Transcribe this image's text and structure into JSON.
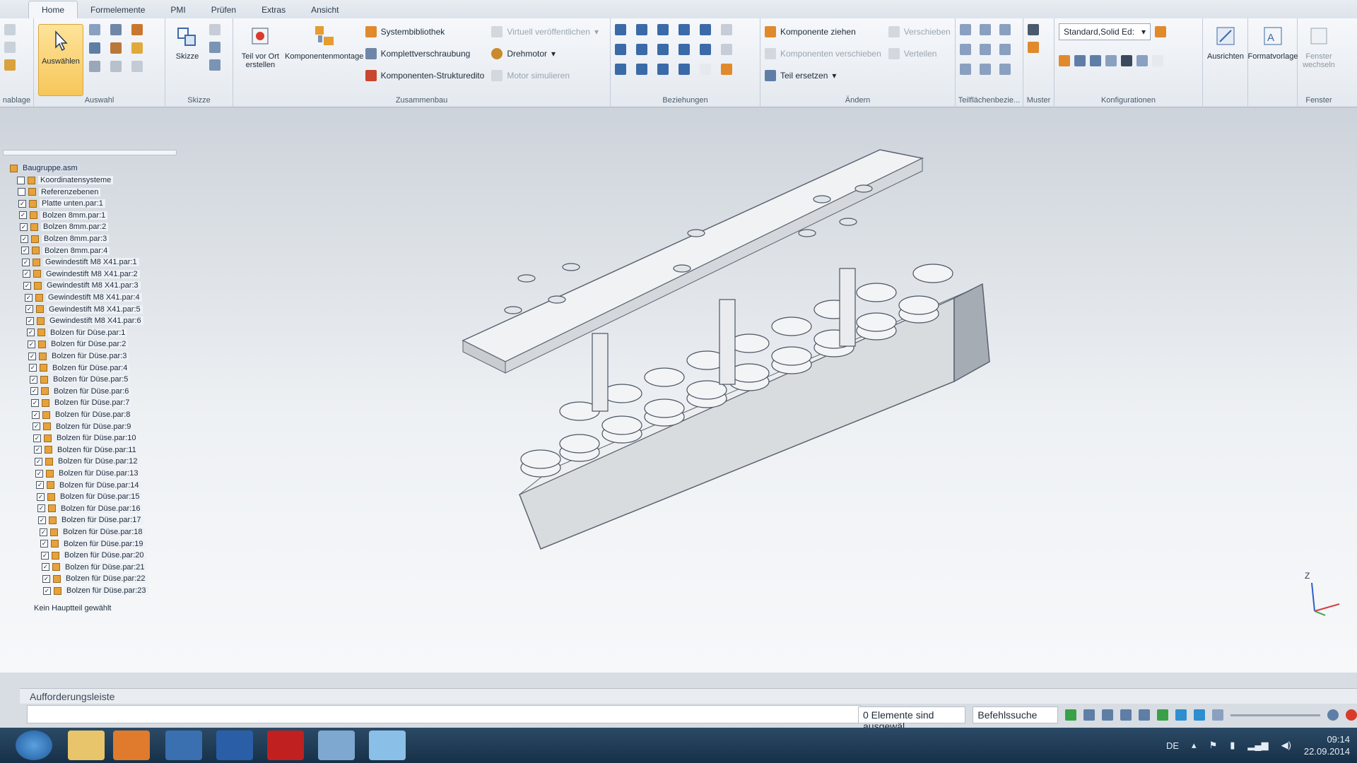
{
  "tabs": [
    "Home",
    "Formelemente",
    "PMI",
    "Prüfen",
    "Extras",
    "Ansicht"
  ],
  "ribbon": {
    "group_auswahl": {
      "label": "Auswahl",
      "button": "Auswählen"
    },
    "group_left": {
      "label": "nablage"
    },
    "group_skizze": {
      "label": "Skizze",
      "button": "Skizze"
    },
    "group_zusammenbau": {
      "label": "Zusammenbau",
      "teil_vor_ort": "Teil vor Ort erstellen",
      "komponentenmontage": "Komponentenmontage",
      "systembibliothek": "Systembibliothek",
      "komplettverschraubung": "Komplettverschraubung",
      "komponenten_strukturedito": "Komponenten-Strukturedito",
      "virtuell": "Virtuell veröffentlichen",
      "drehmotor": "Drehmotor",
      "motor_simulieren": "Motor simulieren"
    },
    "group_beziehungen": {
      "label": "Beziehungen"
    },
    "group_aendern": {
      "label": "Ändern",
      "komponente_ziehen": "Komponente ziehen",
      "komponenten_verschieben": "Komponenten verschieben",
      "teil_ersetzen": "Teil ersetzen",
      "verschieben": "Verschieben",
      "verteilen": "Verteilen"
    },
    "group_teilflaechen": {
      "label": "Teilflächenbezie..."
    },
    "group_muster": {
      "label": "Muster"
    },
    "group_konfig": {
      "label": "Konfigurationen",
      "combo": "Standard,Solid Ed:"
    },
    "group_ausrichten": {
      "label": "Ausrichten"
    },
    "group_formatvorlage": {
      "label": "Formatvorlage"
    },
    "group_fenster": {
      "label": "Fenster",
      "button": "Fenster wechseln"
    }
  },
  "tree": {
    "root": "Baugruppe.asm",
    "items": [
      "Koordinatensysteme",
      "Referenzebenen",
      "Platte unten.par:1",
      "Bolzen 8mm.par:1",
      "Bolzen 8mm.par:2",
      "Bolzen 8mm.par:3",
      "Bolzen 8mm.par:4",
      "Gewindestift M8 X41.par:1",
      "Gewindestift M8 X41.par:2",
      "Gewindestift M8 X41.par:3",
      "Gewindestift M8 X41.par:4",
      "Gewindestift M8 X41.par:5",
      "Gewindestift M8 X41.par:6",
      "Bolzen für Düse.par:1",
      "Bolzen für Düse.par:2",
      "Bolzen für Düse.par:3",
      "Bolzen für Düse.par:4",
      "Bolzen für Düse.par:5",
      "Bolzen für Düse.par:6",
      "Bolzen für Düse.par:7",
      "Bolzen für Düse.par:8",
      "Bolzen für Düse.par:9",
      "Bolzen für Düse.par:10",
      "Bolzen für Düse.par:11",
      "Bolzen für Düse.par:12",
      "Bolzen für Düse.par:13",
      "Bolzen für Düse.par:14",
      "Bolzen für Düse.par:15",
      "Bolzen für Düse.par:16",
      "Bolzen für Düse.par:17",
      "Bolzen für Düse.par:18",
      "Bolzen für Düse.par:19",
      "Bolzen für Düse.par:20",
      "Bolzen für Düse.par:21",
      "Bolzen für Düse.par:22",
      "Bolzen für Düse.par:23"
    ],
    "status": "Kein Hauptteil gewählt"
  },
  "axis": {
    "z": "Z"
  },
  "prompt_bar": "Aufforderungsleiste",
  "status": {
    "selection": "0 Elemente sind ausgewäl",
    "befehlssuche": "Befehlssuche"
  },
  "taskbar": {
    "lang": "DE",
    "time": "09:14",
    "date": "22.09.2014"
  }
}
